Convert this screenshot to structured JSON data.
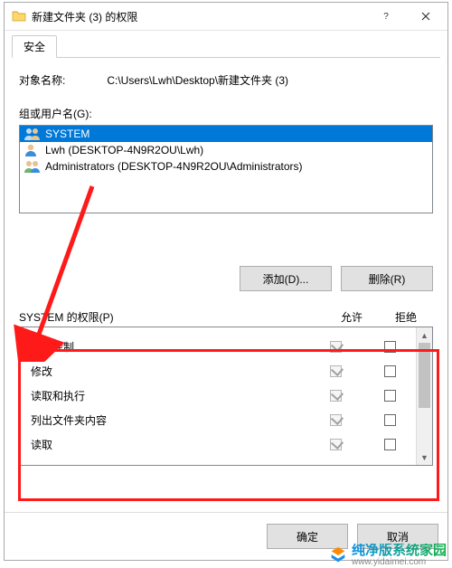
{
  "window": {
    "title": "新建文件夹 (3) 的权限"
  },
  "tab": {
    "label": "安全"
  },
  "object": {
    "label": "对象名称:",
    "path": "C:\\Users\\Lwh\\Desktop\\新建文件夹 (3)"
  },
  "groups": {
    "label": "组或用户名(G):",
    "items": [
      {
        "name": "SYSTEM",
        "selected": true
      },
      {
        "name": "Lwh (DESKTOP-4N9R2OU\\Lwh)",
        "selected": false
      },
      {
        "name": "Administrators (DESKTOP-4N9R2OU\\Administrators)",
        "selected": false
      }
    ]
  },
  "buttons": {
    "add": "添加(D)...",
    "remove": "删除(R)",
    "ok": "确定",
    "cancel": "取消"
  },
  "perm": {
    "header": "SYSTEM 的权限(P)",
    "allow": "允许",
    "deny": "拒绝",
    "rows": [
      {
        "name": "完全控制",
        "allow": true,
        "deny": false
      },
      {
        "name": "修改",
        "allow": true,
        "deny": false
      },
      {
        "name": "读取和执行",
        "allow": true,
        "deny": false
      },
      {
        "name": "列出文件夹内容",
        "allow": true,
        "deny": false
      },
      {
        "name": "读取",
        "allow": true,
        "deny": false
      }
    ]
  },
  "watermark": {
    "brand": "纯净版系统家园",
    "url": "www.yidaimei.com"
  }
}
